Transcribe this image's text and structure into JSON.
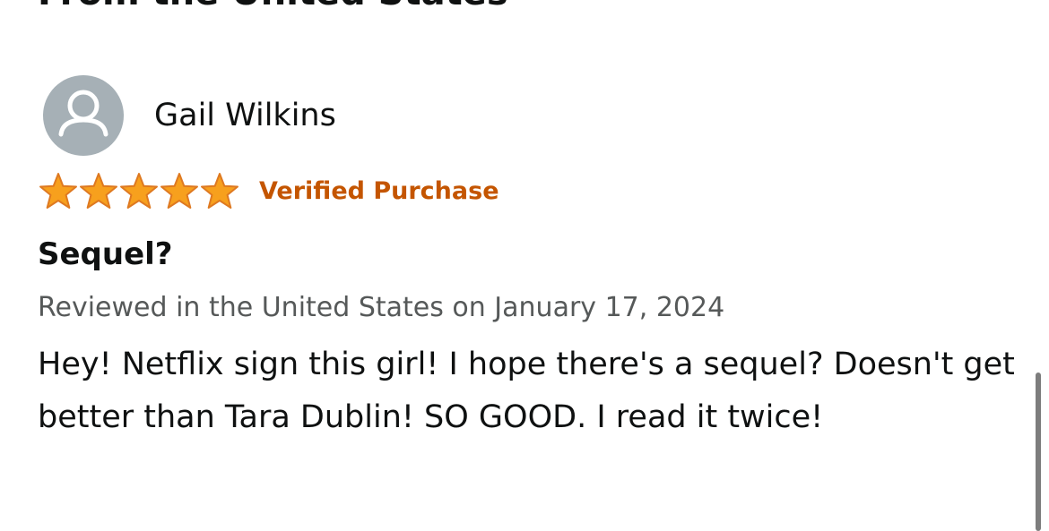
{
  "section": {
    "heading": "From the United States"
  },
  "review": {
    "reviewer_name": "Gail Wilkins",
    "avatar_icon": "user-silhouette-icon",
    "rating": 5,
    "rating_max": 5,
    "verified_label": "Verified Purchase",
    "title": "Sequel?",
    "date_line": "Reviewed in the United States on January 17, 2024",
    "body": "Hey! Netflix sign this girl! I hope there's a sequel? Doesn't get better than Tara Dublin! SO GOOD. I read it twice!"
  },
  "colors": {
    "star_fill": "#f7a01d",
    "star_stroke": "#de7921",
    "verified": "#c45500",
    "date": "#565959",
    "avatar_bg": "#a6b0b6"
  }
}
